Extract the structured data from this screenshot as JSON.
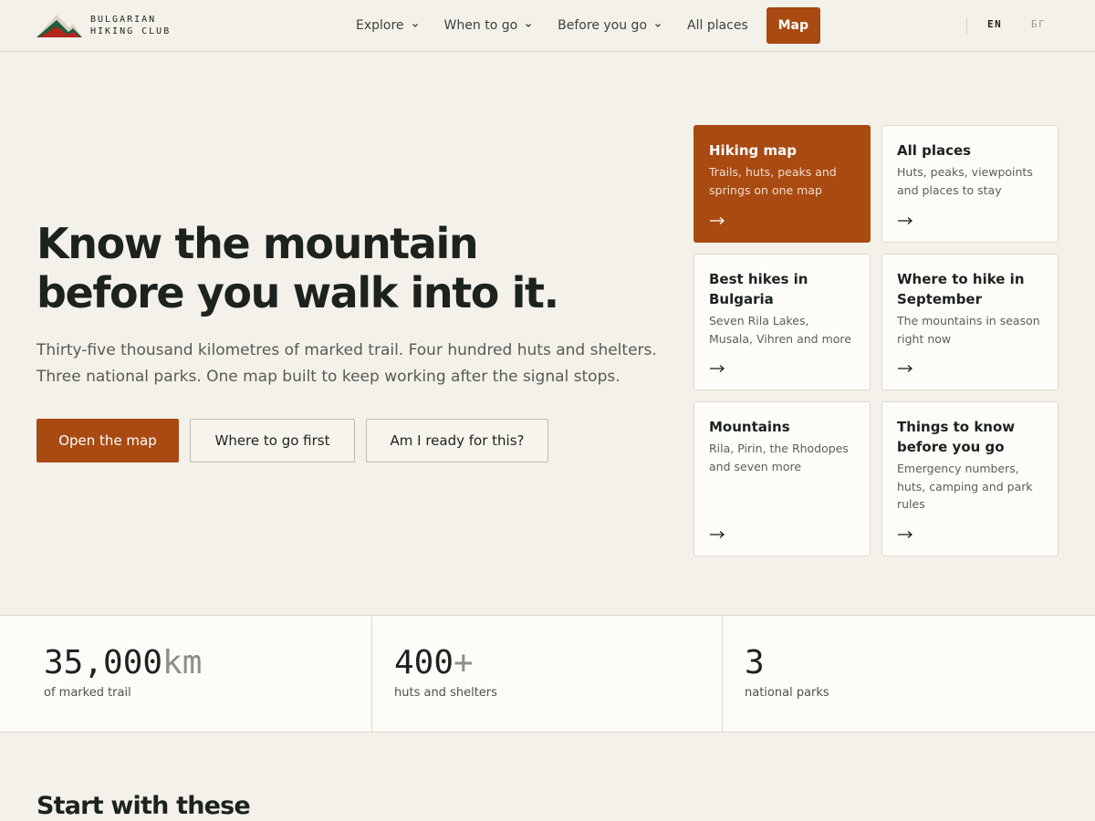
{
  "brand": {
    "line1": "BULGARIAN",
    "line2": "HIKING CLUB",
    "logo_icon": "mountain-logo-icon"
  },
  "nav": {
    "items": [
      {
        "label": "Explore",
        "has_dropdown": true
      },
      {
        "label": "When to go",
        "has_dropdown": true
      },
      {
        "label": "Before you go",
        "has_dropdown": true
      },
      {
        "label": "All places",
        "has_dropdown": false
      }
    ],
    "map_button": "Map"
  },
  "lang": {
    "en": "EN",
    "bg": "БГ",
    "active": "EN"
  },
  "hero": {
    "title_line1": "Know the mountain",
    "title_line2": "before you walk into it.",
    "lede_line1": "Thirty-five thousand kilometres of marked trail. Four hundred huts and shelters.",
    "lede_line2": "Three national parks. One map built to keep working after the signal stops.",
    "cta_primary": "Open the map",
    "cta_where": "Where to go first",
    "cta_ready": "Am I ready for this?"
  },
  "cards": [
    {
      "title": "Hiking map",
      "desc": "Trails, huts, peaks and springs on one map",
      "accent": true
    },
    {
      "title": "All places",
      "desc": "Huts, peaks, viewpoints and places to stay",
      "accent": false
    },
    {
      "title": "Best hikes in Bulgaria",
      "desc": "Seven Rila Lakes, Musala, Vihren and more",
      "accent": false
    },
    {
      "title": "Where to hike in September",
      "desc": "The mountains in season right now",
      "accent": false
    },
    {
      "title": "Mountains",
      "desc": "Rila, Pirin, the Rhodopes and seven more",
      "accent": false
    },
    {
      "title": "Things to know before you go",
      "desc": "Emergency numbers, huts, camping and park rules",
      "accent": false
    }
  ],
  "stats": [
    {
      "value": "35,000",
      "unit": "km",
      "label": "of marked trail"
    },
    {
      "value": "400",
      "unit": "+",
      "label": "huts and shelters"
    },
    {
      "value": "3",
      "unit": "",
      "label": "national parks"
    }
  ],
  "section": {
    "title": "Start with these"
  },
  "colors": {
    "accent": "#a84a12",
    "background": "#f4f1ea",
    "card_bg": "#fdfcf8",
    "text": "#1c231f",
    "logo_green": "#1f5c3a",
    "logo_red": "#b3261e"
  }
}
